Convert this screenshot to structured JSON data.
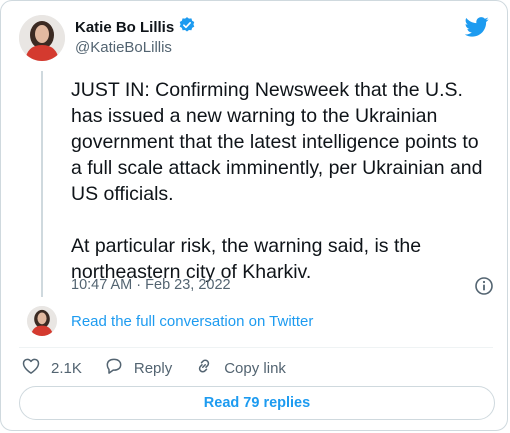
{
  "author": {
    "name": "Katie Bo Lillis",
    "handle": "@KatieBoLillis",
    "verified": true
  },
  "tweet": {
    "paragraphs": [
      "JUST IN: Confirming Newsweek that the U.S. has issued a new warning to the Ukrainian government that the latest intelligence points to a full scale attack imminently, per Ukrainian and US officials.",
      "At particular risk, the warning said, is the northeastern city of Kharkiv."
    ],
    "timestamp": "10:47 AM · Feb 23, 2022"
  },
  "conversation_link": "Read the full conversation on Twitter",
  "actions": {
    "like_count": "2.1K",
    "reply_label": "Reply",
    "copy_label": "Copy link"
  },
  "read_replies": "Read 79 replies",
  "colors": {
    "accent": "#1d9bf0",
    "text": "#0f1419",
    "muted": "#536471",
    "border": "#cfd9de"
  },
  "icons": [
    "verified-badge-icon",
    "twitter-bird-icon",
    "info-icon",
    "heart-icon",
    "reply-icon",
    "link-icon"
  ]
}
